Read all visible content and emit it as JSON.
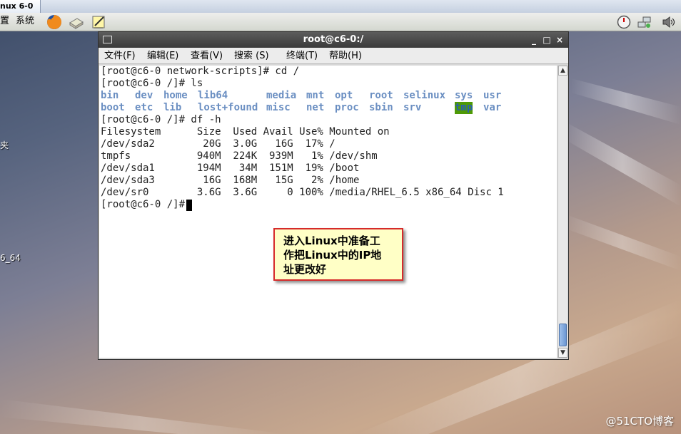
{
  "vm_tab": {
    "title": "nux 6-0"
  },
  "panel": {
    "menus": [
      "置",
      "系统"
    ],
    "app_icons": [
      "firefox-icon",
      "mail-icon",
      "notes-icon"
    ],
    "tray_icons": [
      "timer-icon",
      "network-icon",
      "volume-icon"
    ]
  },
  "desktop": {
    "label_folder": "夹",
    "label_iso": "6_64"
  },
  "terminal": {
    "title": "root@c6-0:/",
    "menus": [
      "文件(F)",
      "编辑(E)",
      "查看(V)",
      "搜索 (S)",
      "终端(T)",
      "帮助(H)"
    ],
    "lines": [
      "[root@c6-0 network-scripts]# cd /",
      "[root@c6-0 /]# ls"
    ],
    "ls_row1": [
      "bin",
      "dev",
      "home",
      "lib64",
      "media",
      "mnt",
      "opt",
      "root",
      "selinux",
      "sys",
      "usr"
    ],
    "ls_row2": [
      "boot",
      "etc",
      "lib",
      "lost+found",
      "misc",
      "net",
      "proc",
      "sbin",
      "srv",
      "tmp",
      "var"
    ],
    "df_lines": [
      "[root@c6-0 /]# df -h",
      "Filesystem      Size  Used Avail Use% Mounted on",
      "/dev/sda2        20G  3.0G   16G  17% /",
      "tmpfs           940M  224K  939M   1% /dev/shm",
      "/dev/sda1       194M   34M  151M  19% /boot",
      "/dev/sda3        16G  168M   15G   2% /home",
      "/dev/sr0        3.6G  3.6G     0 100% /media/RHEL_6.5 x86_64 Disc 1",
      "[root@c6-0 /]# "
    ],
    "window_buttons": {
      "minimize": "_",
      "maximize": "□",
      "close": "×"
    }
  },
  "callout": {
    "lines": [
      "进入Linux中准备工",
      "作把Linux中的IP地",
      "址更改好"
    ]
  },
  "watermark": "@51CTO博客",
  "colors": {
    "ls_dir": "#6b8fc2",
    "tmp_highlight": "#4e9a06",
    "callout_border": "#d62b2b"
  }
}
